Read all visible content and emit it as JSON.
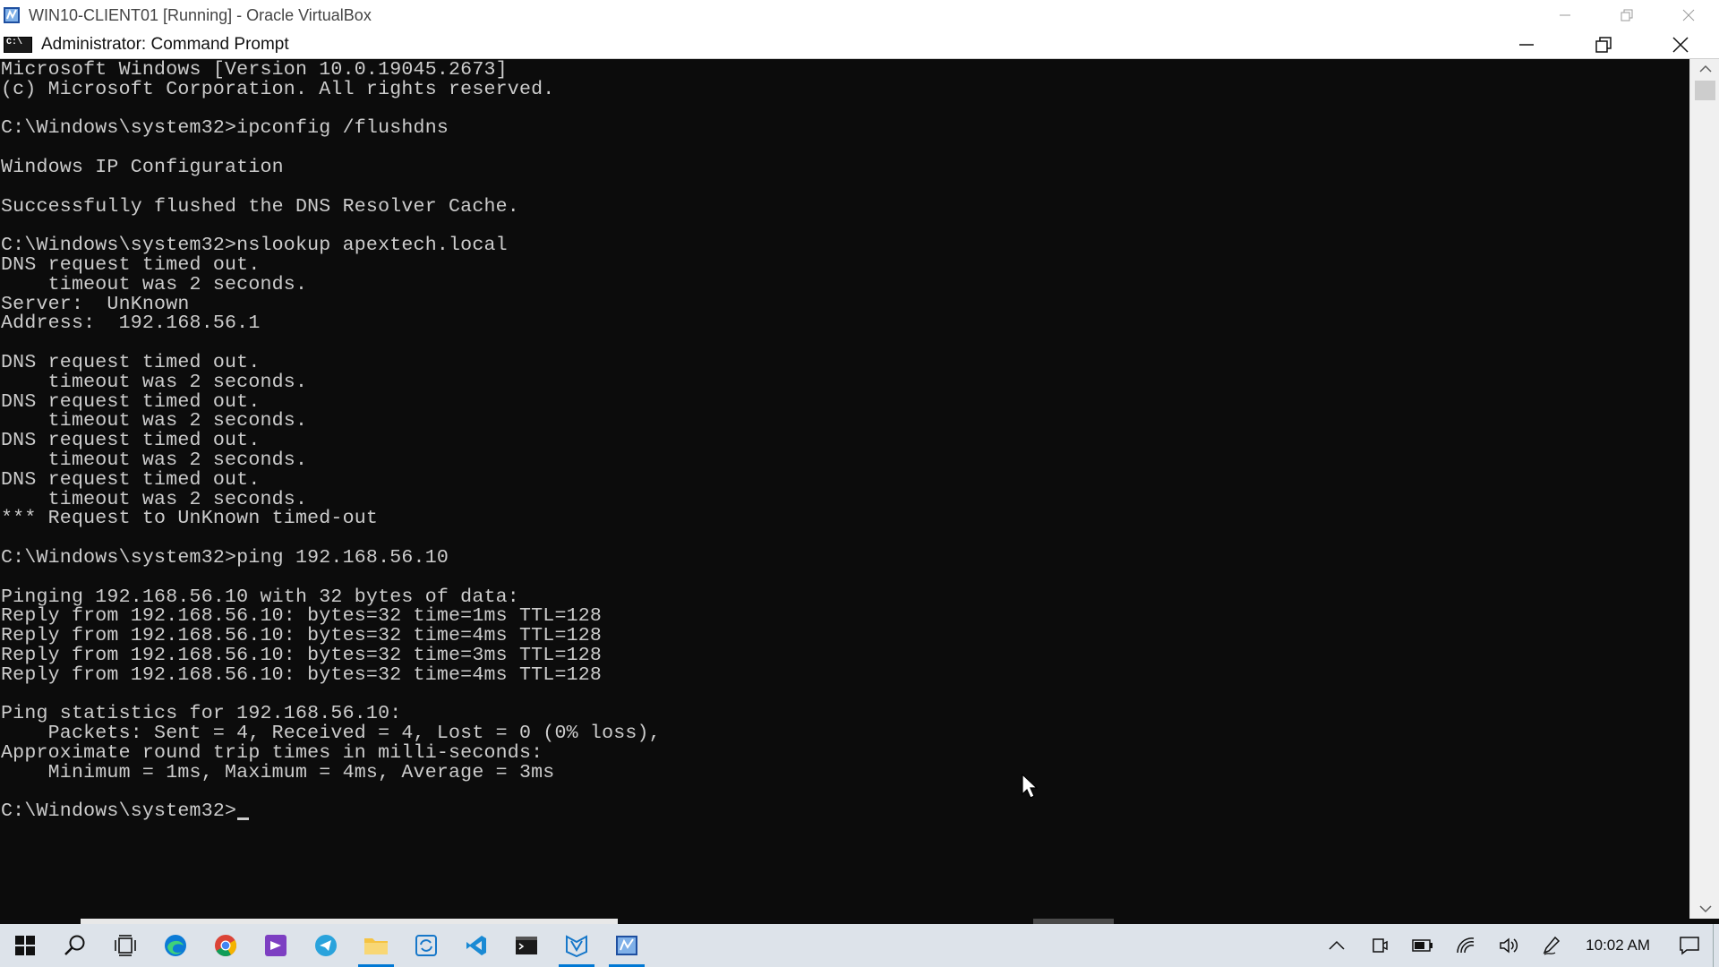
{
  "vbox_window": {
    "title": "WIN10-CLIENT01 [Running] - Oracle VirtualBox",
    "icon": "virtualbox-icon",
    "controls": [
      "minimize-icon",
      "restore-icon",
      "close-icon"
    ]
  },
  "cmd_window": {
    "title": "Administrator: Command Prompt",
    "icon": "command-prompt-icon",
    "controls": [
      "minimize-icon",
      "restore-icon",
      "close-icon"
    ]
  },
  "console": {
    "lines": [
      "Microsoft Windows [Version 10.0.19045.2673]",
      "(c) Microsoft Corporation. All rights reserved.",
      "",
      "C:\\Windows\\system32>ipconfig /flushdns",
      "",
      "Windows IP Configuration",
      "",
      "Successfully flushed the DNS Resolver Cache.",
      "",
      "C:\\Windows\\system32>nslookup apextech.local",
      "DNS request timed out.",
      "    timeout was 2 seconds.",
      "Server:  UnKnown",
      "Address:  192.168.56.1",
      "",
      "DNS request timed out.",
      "    timeout was 2 seconds.",
      "DNS request timed out.",
      "    timeout was 2 seconds.",
      "DNS request timed out.",
      "    timeout was 2 seconds.",
      "DNS request timed out.",
      "    timeout was 2 seconds.",
      "*** Request to UnKnown timed-out",
      "",
      "C:\\Windows\\system32>ping 192.168.56.10",
      "",
      "Pinging 192.168.56.10 with 32 bytes of data:",
      "Reply from 192.168.56.10: bytes=32 time=1ms TTL=128",
      "Reply from 192.168.56.10: bytes=32 time=4ms TTL=128",
      "Reply from 192.168.56.10: bytes=32 time=3ms TTL=128",
      "Reply from 192.168.56.10: bytes=32 time=4ms TTL=128",
      "",
      "Ping statistics for 192.168.56.10:",
      "    Packets: Sent = 4, Received = 4, Lost = 0 (0% loss),",
      "Approximate round trip times in milli-seconds:",
      "    Minimum = 1ms, Maximum = 4ms, Average = 3ms",
      ""
    ],
    "prompt": "C:\\Windows\\system32>",
    "text_color": "#cccccc",
    "background_color": "#0c0c0c"
  },
  "taskbar": {
    "apps": [
      {
        "name": "start-button",
        "icon": "windows-logo-icon",
        "active": false
      },
      {
        "name": "search-button",
        "icon": "search-icon",
        "active": false
      },
      {
        "name": "task-view-button",
        "icon": "task-view-icon",
        "active": false
      },
      {
        "name": "edge-button",
        "icon": "edge-icon",
        "active": false
      },
      {
        "name": "chrome-button",
        "icon": "chrome-icon",
        "active": false
      },
      {
        "name": "visual-studio-button",
        "icon": "visual-studio-icon",
        "active": false
      },
      {
        "name": "telegram-button",
        "icon": "telegram-icon",
        "active": false
      },
      {
        "name": "file-explorer-button",
        "icon": "folder-icon",
        "active": true
      },
      {
        "name": "sync-app-button",
        "icon": "sync-icon",
        "active": false
      },
      {
        "name": "vscode-button",
        "icon": "vscode-icon",
        "active": false
      },
      {
        "name": "terminal-button",
        "icon": "terminal-icon",
        "active": false
      },
      {
        "name": "virtualbox-manager-button",
        "icon": "virtualbox-manager-icon",
        "active": true
      },
      {
        "name": "virtualbox-vm-button",
        "icon": "virtualbox-icon",
        "active": true
      }
    ],
    "tray": [
      "chevron-up-icon",
      "meet-now-icon",
      "battery-icon",
      "wifi-icon",
      "volume-icon",
      "pen-icon"
    ],
    "clock": "10:02 AM",
    "notification_icon": "notification-icon",
    "accent_color": "#0078d4"
  }
}
